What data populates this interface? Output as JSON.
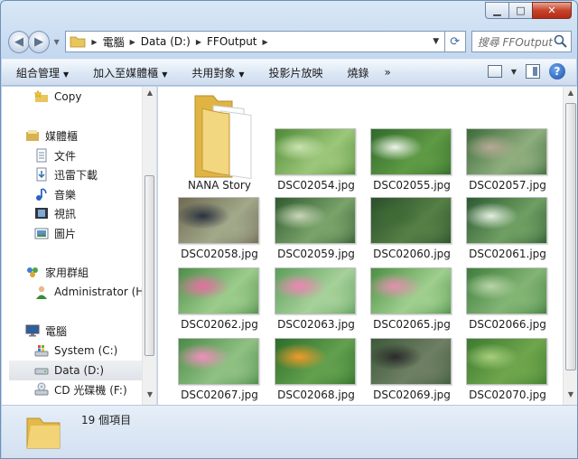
{
  "window": {
    "caption": {
      "minimize": "▁",
      "maximize": "□",
      "close": "✕"
    }
  },
  "address_bar": {
    "crumbs": [
      "電腦",
      "Data (D:)",
      "FFOutput"
    ],
    "search_placeholder": "搜尋 FFOutput"
  },
  "command_bar": {
    "items": [
      {
        "label": "組合管理",
        "has_dropdown": true
      },
      {
        "label": "加入至媒體櫃",
        "has_dropdown": true
      },
      {
        "label": "共用對象",
        "has_dropdown": true
      },
      {
        "label": "投影片放映",
        "has_dropdown": false
      },
      {
        "label": "燒錄",
        "has_dropdown": false
      }
    ],
    "more": "»"
  },
  "nav_pane": {
    "items": [
      {
        "label": "Copy",
        "icon": "favorite-folder-icon"
      },
      {
        "label": "媒體櫃",
        "icon": "library-icon"
      },
      {
        "label": "文件",
        "icon": "documents-icon"
      },
      {
        "label": "迅雷下載",
        "icon": "download-folder-icon"
      },
      {
        "label": "音樂",
        "icon": "music-icon"
      },
      {
        "label": "視訊",
        "icon": "video-icon"
      },
      {
        "label": "圖片",
        "icon": "pictures-icon"
      },
      {
        "label": "家用群組",
        "icon": "homegroup-icon"
      },
      {
        "label": "Administrator (HU",
        "icon": "user-icon"
      },
      {
        "label": "電腦",
        "icon": "computer-icon"
      },
      {
        "label": "System (C:)",
        "icon": "system-drive-icon"
      },
      {
        "label": "Data (D:)",
        "icon": "drive-icon",
        "selected": true
      },
      {
        "label": "CD 光碟機 (F:)",
        "icon": "cd-drive-icon"
      }
    ]
  },
  "files": [
    {
      "name": "NANA Story",
      "type": "folder"
    },
    {
      "name": "DSC02054.jpg",
      "type": "image",
      "colors": [
        "#4e8a35",
        "#9cc77a",
        "#cbe3b0"
      ]
    },
    {
      "name": "DSC02055.jpg",
      "type": "image",
      "colors": [
        "#2f6a2a",
        "#5f9a45",
        "#eef4ea"
      ]
    },
    {
      "name": "DSC02057.jpg",
      "type": "image",
      "colors": [
        "#3c6b3a",
        "#8fae7e",
        "#b7a996"
      ]
    },
    {
      "name": "DSC02058.jpg",
      "type": "image",
      "colors": [
        "#6f6a52",
        "#a2a88a",
        "#2c3240"
      ]
    },
    {
      "name": "DSC02059.jpg",
      "type": "image",
      "colors": [
        "#2f5a30",
        "#7aa36a",
        "#c8d6b8"
      ]
    },
    {
      "name": "DSC02060.jpg",
      "type": "image",
      "colors": [
        "#2b4f2c",
        "#557f45",
        "#3d6b35"
      ]
    },
    {
      "name": "DSC02061.jpg",
      "type": "image",
      "colors": [
        "#2c5a33",
        "#6f9f62",
        "#e5efe2"
      ]
    },
    {
      "name": "DSC02062.jpg",
      "type": "image",
      "colors": [
        "#4f8c4a",
        "#9ccc8c",
        "#e56fa2"
      ]
    },
    {
      "name": "DSC02063.jpg",
      "type": "image",
      "colors": [
        "#5c9e5a",
        "#a6d19a",
        "#ef85b5"
      ]
    },
    {
      "name": "DSC02065.jpg",
      "type": "image",
      "colors": [
        "#4c8f44",
        "#a0cf8f",
        "#e58fb0"
      ]
    },
    {
      "name": "DSC02066.jpg",
      "type": "image",
      "colors": [
        "#3f7d3c",
        "#83b575",
        "#b8d5a8"
      ]
    },
    {
      "name": "DSC02067.jpg",
      "type": "image",
      "colors": [
        "#4a8a47",
        "#8fc183",
        "#f18fbd"
      ]
    },
    {
      "name": "DSC02068.jpg",
      "type": "image",
      "colors": [
        "#2d6d2a",
        "#63a04e",
        "#f09a2a"
      ]
    },
    {
      "name": "DSC02069.jpg",
      "type": "image",
      "colors": [
        "#3d5a3a",
        "#6e7f63",
        "#2b2b2b"
      ]
    },
    {
      "name": "DSC02070.jpg",
      "type": "image",
      "colors": [
        "#3d7a2f",
        "#6fa64c",
        "#a7cf7c"
      ]
    }
  ],
  "status_bar": {
    "item_count": "19 個項目"
  }
}
